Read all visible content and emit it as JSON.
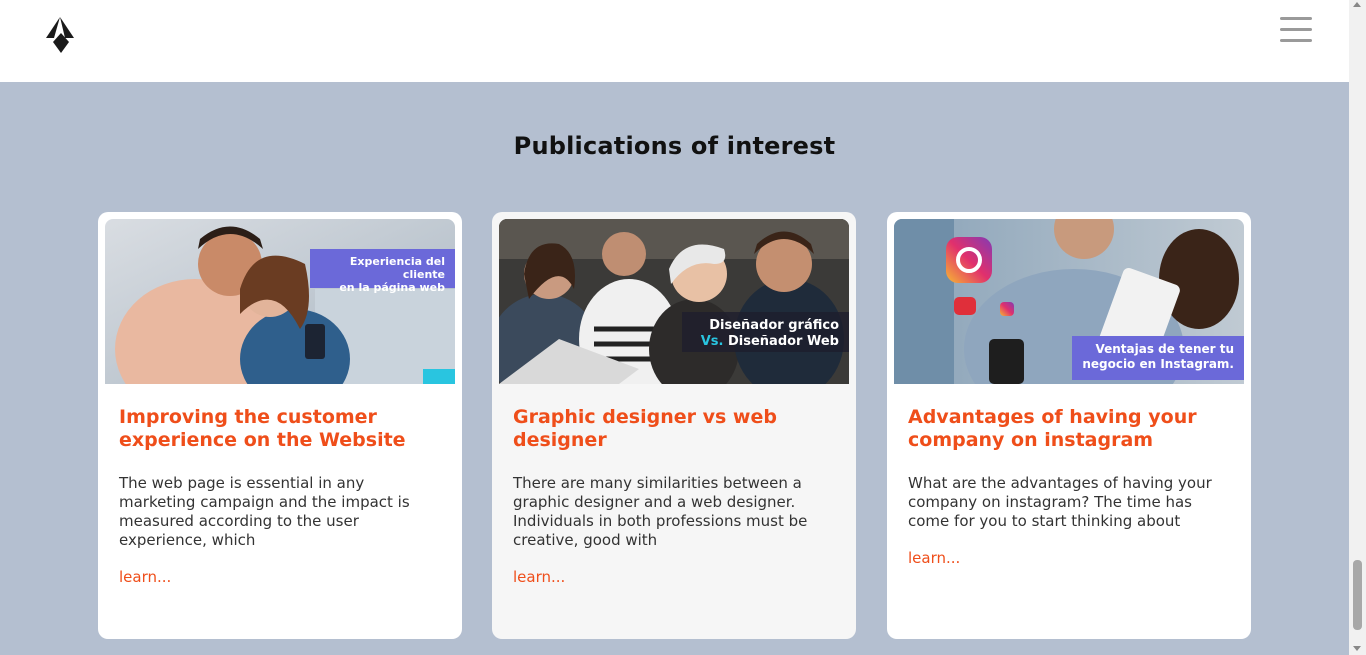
{
  "header": {
    "logo_icon": "brand-logo",
    "menu_icon": "hamburger-menu-icon"
  },
  "section": {
    "title": "Publications of interest"
  },
  "cards": [
    {
      "image_badge": "Experiencia del cliente en la página web",
      "image_badge_line1": "Experiencia del cliente",
      "image_badge_line2": "en la página web",
      "title": "Improving the customer experience on the Website",
      "excerpt": "The web page is essential in any marketing campaign and the impact is measured according to the user experience, which",
      "link": "learn..."
    },
    {
      "image_badge_line1": "Diseñador gráfico",
      "image_badge_vs": "Vs.",
      "image_badge_line2": "Diseñador Web",
      "title": "Graphic designer vs web designer",
      "excerpt": "There are many similarities between a graphic designer and a web designer. Individuals in both professions must be creative, good with",
      "link": "learn..."
    },
    {
      "image_badge_line1": "Ventajas de tener tu",
      "image_badge_line2": "negocio en Instagram.",
      "title": "Advantages of having your company on instagram",
      "excerpt": "What are the advantages of having your company on instagram? The time has come for you to start thinking about",
      "link": "learn..."
    }
  ],
  "colors": {
    "accent": "#ef4e1a",
    "section_bg": "#b4bfd0",
    "badge_bg": "#6b69d9"
  }
}
